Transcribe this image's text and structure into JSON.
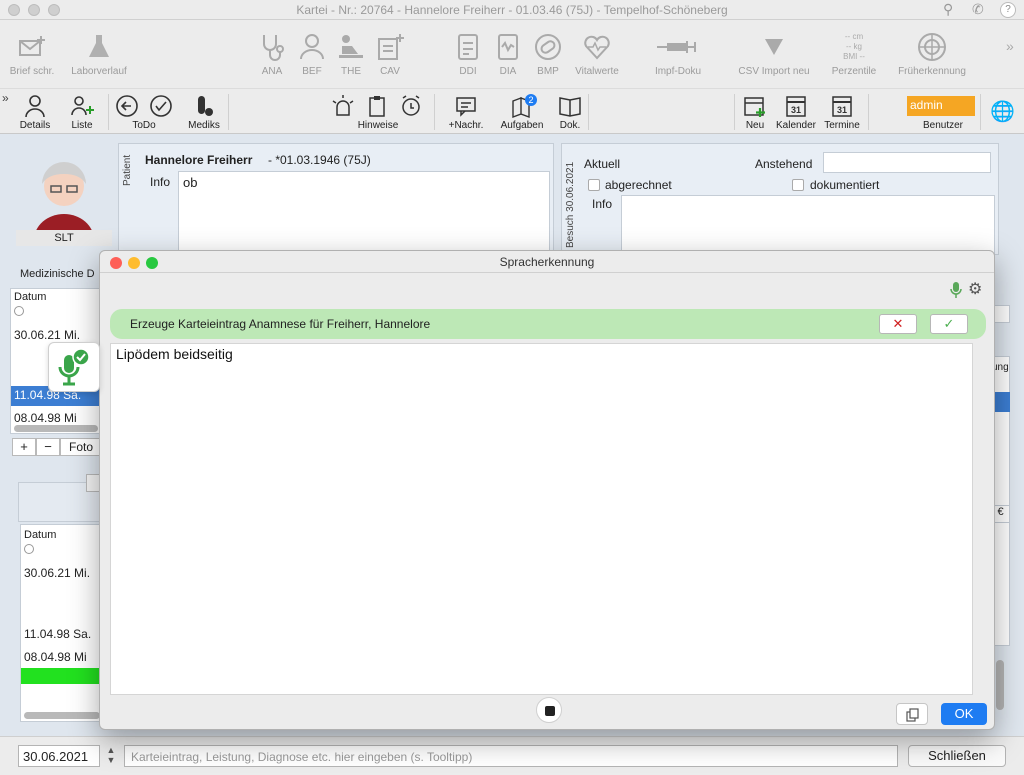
{
  "window": {
    "title": "Kartei - Nr.: 20764 - Hannelore Freiherr - 01.03.46 (75J) - Tempelhof-Schöneberg",
    "help": "?"
  },
  "toolbar_top": [
    {
      "label": "Brief schr.",
      "icon": "letter-icon"
    },
    {
      "label": "Laborverlauf",
      "icon": "flask-icon"
    },
    {
      "label": "ANA",
      "icon": "stethoscope-icon"
    },
    {
      "label": "BEF",
      "icon": "doctor-icon"
    },
    {
      "label": "THE",
      "icon": "treatment-icon"
    },
    {
      "label": "CAV",
      "icon": "clipboard-plus-icon"
    },
    {
      "label": "DDI",
      "icon": "checklist-icon"
    },
    {
      "label": "DIA",
      "icon": "diagnosis-icon"
    },
    {
      "label": "BMP",
      "icon": "pill-icon"
    },
    {
      "label": "Vitalwerte",
      "icon": "heartbeat-icon"
    },
    {
      "label": "Impf-Doku",
      "icon": "syringe-icon"
    },
    {
      "label": "CSV Import neu",
      "icon": "funnel-icon"
    },
    {
      "label": "Perzentile",
      "icon": "metrics-icon"
    },
    {
      "label": "Früherkennung",
      "icon": "radar-icon"
    }
  ],
  "perzentile_readout": [
    "-- cm",
    "-- kg",
    "BMI --"
  ],
  "toolbar_second": {
    "details": "Details",
    "liste": "Liste",
    "todo": "ToDo",
    "mediks": "Mediks",
    "hinweise": "Hinweise",
    "nachr": "+Nachr.",
    "aufgaben": "Aufgaben",
    "aufgaben_badge": "2",
    "dok": "Dok.",
    "neu": "Neu",
    "kalender": "Kalender",
    "termine": "Termine",
    "calendar_day": "31",
    "benutzer": "Benutzer",
    "user": "admin"
  },
  "patient": {
    "side_label": "Patient",
    "name": "Hannelore Freiherr",
    "dob": " - *01.03.1946 (75J)",
    "info_label": "Info",
    "info_value": "ob",
    "avatar_tag": "SLT",
    "section_label": "Medizinische D"
  },
  "visit": {
    "side_label": "Besuch 30.06.2021",
    "aktuell": "Aktuell",
    "anstehend": "Anstehend",
    "abgerechnet": "abgerechnet",
    "dokumentiert": "dokumentiert",
    "info_label": "Info"
  },
  "list_upper": {
    "header": "Datum",
    "rows": [
      "30.06.21  Mi.",
      "11.04.98  Sa.",
      "08.04.98  Mi"
    ],
    "add": "+",
    "remove": "−",
    "foto": "Foto"
  },
  "list_lower": {
    "header": "Datum",
    "rows": [
      "30.06.21  Mi.",
      "11.04.98  Sa.",
      "08.04.98  Mi"
    ]
  },
  "right_edge": {
    "ung": "ung",
    "eur": "€"
  },
  "dialog": {
    "title": "Sprach­erkennung",
    "banner": "Erzeuge Karteieintrag Anamnese für Freiherr, Hannelore",
    "cancel": "✕",
    "confirm": "✓",
    "text": "Lipödem beidseitig",
    "ok": "OK"
  },
  "bottom": {
    "date": "30.06.2021",
    "entry_placeholder": "Karteieintrag, Leistung, Diagnose etc. hier eingeben (s. Tooltipp)",
    "close": "Schließen"
  },
  "colors": {
    "accent": "#1e7cf2",
    "selection": "#3c7ed3",
    "banner": "#bde8b6",
    "admin": "#f5a623",
    "green_row": "#22e11f"
  }
}
